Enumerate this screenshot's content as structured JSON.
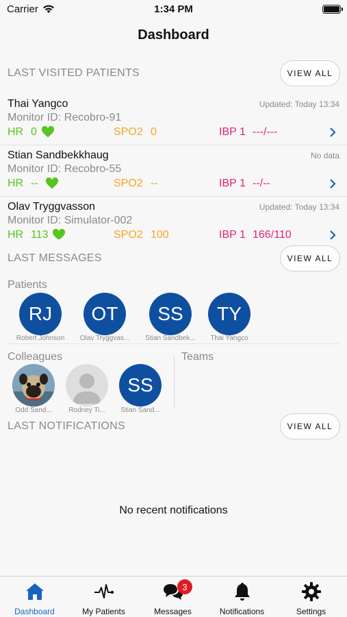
{
  "status_bar": {
    "carrier": "Carrier",
    "time": "1:34 PM"
  },
  "nav": {
    "title": "Dashboard"
  },
  "last_visited": {
    "header": "LAST VISITED PATIENTS",
    "view_all": "VIEW ALL",
    "patients": [
      {
        "name": "Thai Yangco",
        "monitor": "Monitor ID: Recobro-91",
        "updated": "Updated: Today 13:34",
        "hr_label": "HR",
        "hr": "0",
        "spo2_label": "SPO2",
        "spo2": "0",
        "ibp_label": "IBP 1",
        "ibp": "---/---"
      },
      {
        "name": "Stian Sandbekkhaug",
        "monitor": "Monitor ID: Recobro-55",
        "updated": "No data",
        "hr_label": "HR",
        "hr": "--",
        "spo2_label": "SPO2",
        "spo2": "--",
        "ibp_label": "IBP 1",
        "ibp": "--/--"
      },
      {
        "name": "Olav Tryggvasson",
        "monitor": "Monitor ID: Simulator-002",
        "updated": "Updated: Today 13:34",
        "hr_label": "HR",
        "hr": "113",
        "spo2_label": "SPO2",
        "spo2": "100",
        "ibp_label": "IBP 1",
        "ibp": "166/110"
      }
    ]
  },
  "last_messages": {
    "header": "LAST MESSAGES",
    "view_all": "VIEW ALL",
    "patients_label": "Patients",
    "patients": [
      {
        "initials": "RJ",
        "name": "Robert Johnson"
      },
      {
        "initials": "OT",
        "name": "Olav Tryggvas..."
      },
      {
        "initials": "SS",
        "name": "Stian Sandbek..."
      },
      {
        "initials": "TY",
        "name": "Thai Yangco"
      }
    ],
    "colleagues_label": "Colleagues",
    "colleagues": [
      {
        "initials": "",
        "name": "Odd Sand..."
      },
      {
        "initials": "",
        "name": "Rodney Ti..."
      },
      {
        "initials": "SS",
        "name": "Stian Sand..."
      }
    ],
    "teams_label": "Teams"
  },
  "last_notifications": {
    "header": "LAST NOTIFICATIONS",
    "view_all": "VIEW ALL",
    "empty": "No recent notifications"
  },
  "tabbar": {
    "tabs": [
      {
        "label": "Dashboard",
        "icon": "home-icon",
        "active": true
      },
      {
        "label": "My Patients",
        "icon": "pulse-icon",
        "active": false
      },
      {
        "label": "Messages",
        "icon": "chat-icon",
        "active": false,
        "badge": "3"
      },
      {
        "label": "Notifications",
        "icon": "bell-icon",
        "active": false
      },
      {
        "label": "Settings",
        "icon": "gear-icon",
        "active": false
      }
    ]
  },
  "colors": {
    "accent": "#1565c0",
    "avatar": "#0f4fa0",
    "hr": "#56c51f",
    "spo2": "#f5a523",
    "ibp": "#e0237a",
    "badge": "#e11b22"
  }
}
